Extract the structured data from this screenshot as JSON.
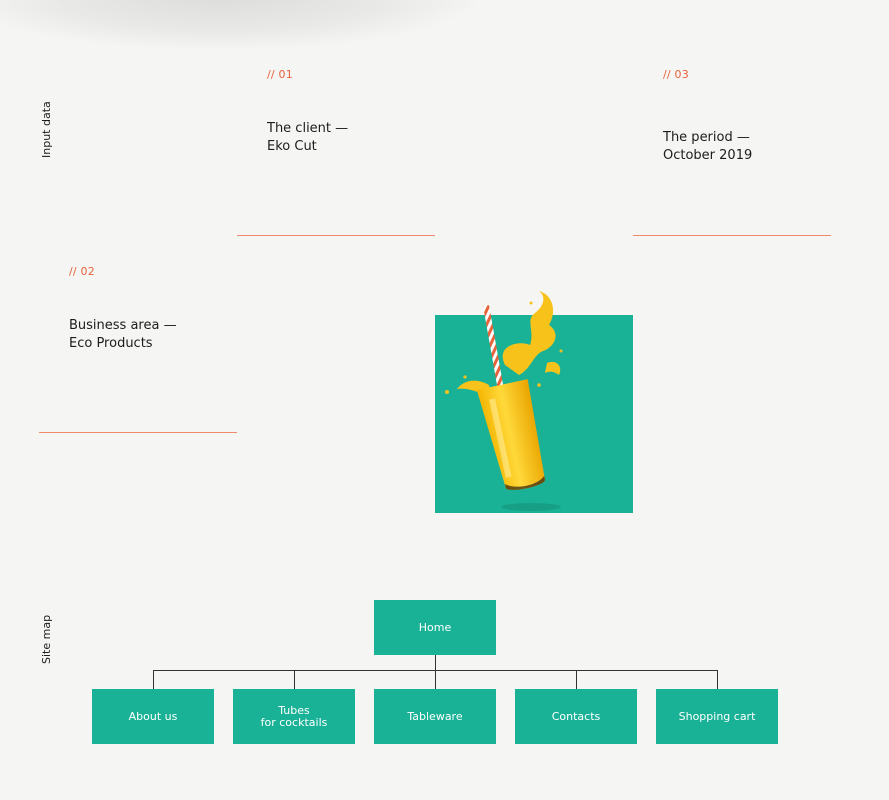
{
  "sections": {
    "input_label": "Input data",
    "sitemap_label": "Site map"
  },
  "input_data": {
    "items": [
      {
        "number": "// 01",
        "line1": "The client —",
        "line2": "Eko Cut"
      },
      {
        "number": "// 02",
        "line1": "Business area —",
        "line2": "Eco Products"
      },
      {
        "number": "// 03",
        "line1": "The period —",
        "line2": "October 2019"
      }
    ]
  },
  "colors": {
    "accent": "#e8623a",
    "teal": "#1ab296",
    "background": "#f5f5f4",
    "juice": "#f7c21a"
  },
  "sitemap": {
    "root": "Home",
    "children": [
      {
        "label": "About us"
      },
      {
        "label": "Tubes\nfor cocktails"
      },
      {
        "label": "Tableware"
      },
      {
        "label": "Contacts"
      },
      {
        "label": "Shopping cart"
      }
    ]
  }
}
